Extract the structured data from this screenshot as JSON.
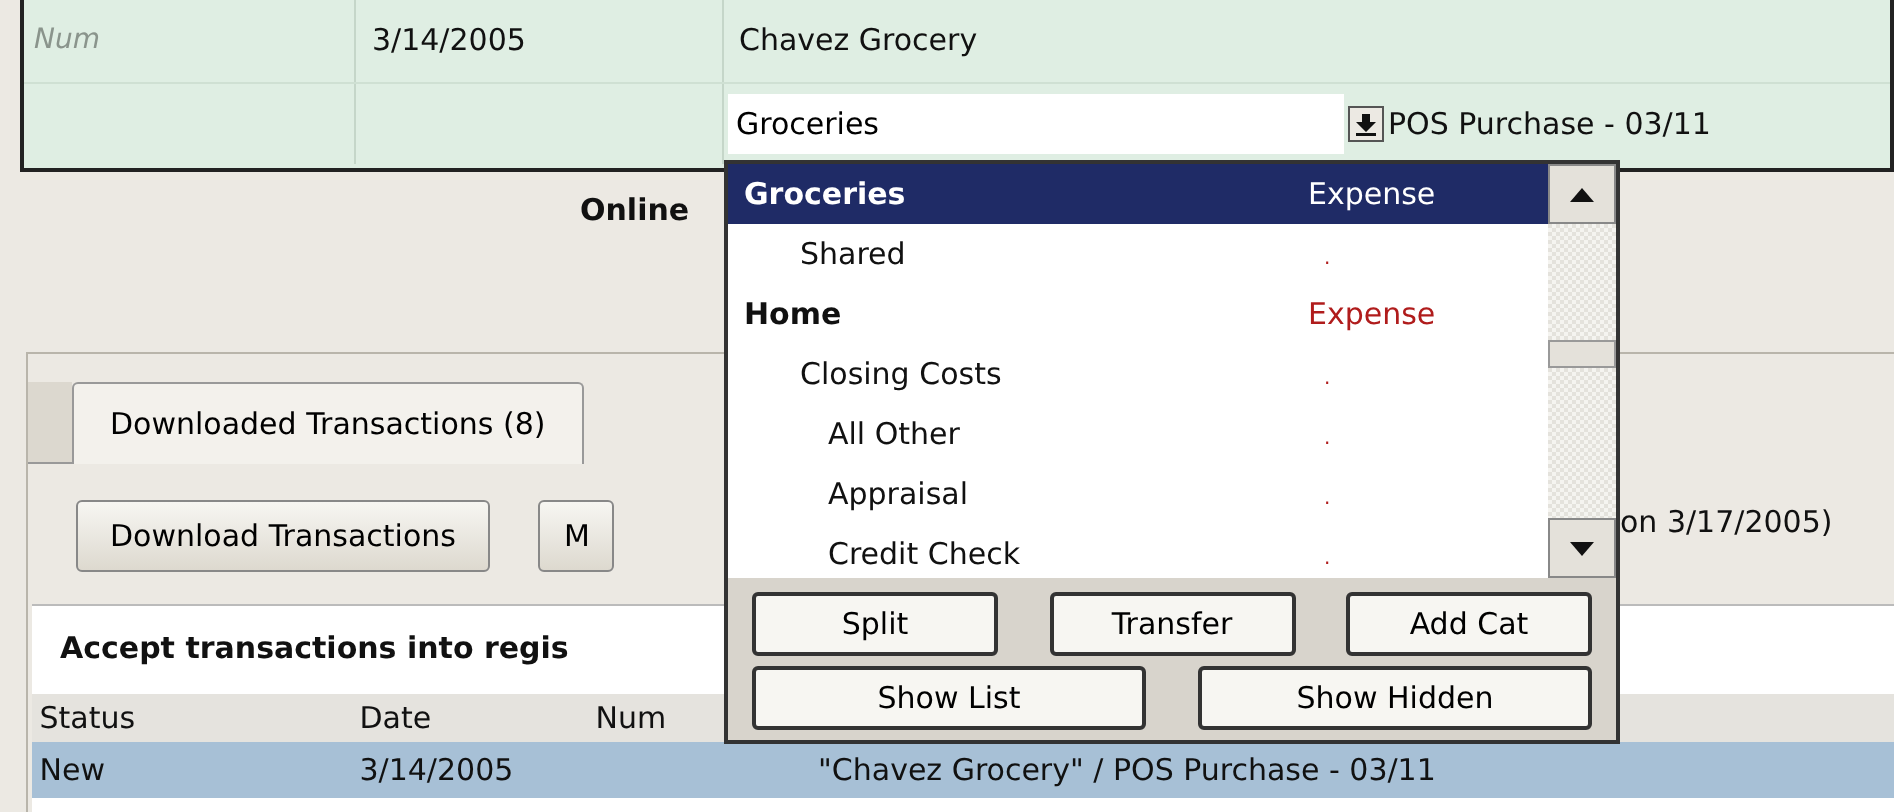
{
  "register": {
    "num_placeholder": "Num",
    "date": "3/14/2005",
    "payee": "Chavez Grocery",
    "category": "Groceries",
    "memo": "POS Purchase -  03/11"
  },
  "online_label": "Online",
  "tabs": [
    {
      "label": "Downloaded Transactions (8)",
      "selected": true
    }
  ],
  "buttons": [
    "Download Transactions",
    "M"
  ],
  "last_download": "on 3/17/2005)",
  "section_title": "Accept transactions into regis",
  "table": {
    "columns": [
      "Status",
      "Date",
      "Num"
    ],
    "rows": [
      {
        "status": "New",
        "date": "3/14/2005",
        "description": "\"Chavez Grocery\" / POS Purchase -  03/11",
        "selected": true
      }
    ]
  },
  "category_popup": {
    "items": [
      {
        "name": "Groceries",
        "type": "Expense",
        "selected": true,
        "children": [
          {
            "name": "Shared",
            "type": ".",
            "selected": false
          }
        ]
      },
      {
        "name": "Home",
        "type": "Expense",
        "selected": false,
        "children": [
          {
            "name": "Closing Costs",
            "type": ".",
            "selected": false,
            "children": [
              {
                "name": "All Other",
                "type": ".",
                "selected": false
              },
              {
                "name": "Appraisal",
                "type": ".",
                "selected": false
              },
              {
                "name": "Credit Check",
                "type": ".",
                "selected": false
              }
            ]
          }
        ]
      }
    ],
    "buttons": [
      [
        "Split",
        "Transfer",
        "Add Cat"
      ],
      [
        "Show List",
        "Show Hidden"
      ]
    ]
  }
}
